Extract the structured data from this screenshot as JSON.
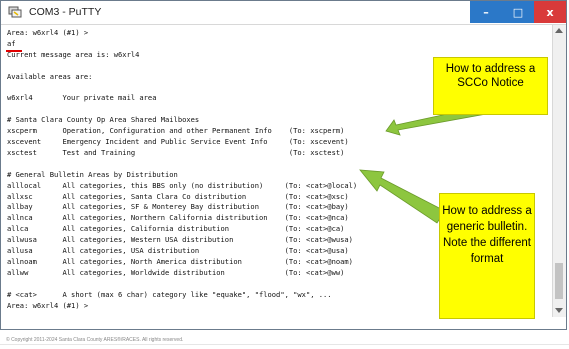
{
  "window": {
    "title": "COM3 - PuTTY"
  },
  "window_controls": {
    "minimize": "–",
    "maximize": "□",
    "close": "x"
  },
  "terminal": {
    "lines": [
      "Area: w6xrl4 (#1) >",
      "af",
      "Current message area is: w6xrl4",
      "",
      "Available areas are:",
      "",
      "w6xrl4       Your private mail area",
      "",
      "# Santa Clara County Op Area Shared Mailboxes",
      "xscperm      Operation, Configuration and other Permanent Info    (To: xscperm)",
      "xscevent     Emergency Incident and Public Service Event Info     (To: xscevent)",
      "xsctest      Test and Training                                    (To: xsctest)",
      "",
      "# General Bulletin Areas by Distribution",
      "alllocal     All categories, this BBS only (no distribution)     (To: <cat>@local)",
      "allxsc       All categories, Santa Clara Co distribution         (To: <cat>@xsc)",
      "allbay       All categories, SF & Monterey Bay distribution      (To: <cat>@bay)",
      "allnca       All categories, Northern California distribution    (To: <cat>@nca)",
      "allca        All categories, California distribution             (To: <cat>@ca)",
      "allwusa      All categories, Western USA distribution            (To: <cat>@wusa)",
      "allusa       All categories, USA distribution                    (To: <cat>@usa)",
      "allnoam      All categories, North America distribution          (To: <cat>@noam)",
      "allww        All categories, Worldwide distribution              (To: <cat>@ww)",
      "",
      "# <cat>      A short (max 6 char) category like \"equake\", \"flood\", \"wx\", ...",
      "Area: w6xrl4 (#1) >"
    ]
  },
  "callouts": {
    "scco_notice": "How to address a SCCo Notice",
    "generic_bulletin": "How to address a generic bulletin.  Note the different format"
  },
  "colors": {
    "callout_fill": "#ffff00",
    "arrow_fill": "#8dc63f",
    "close_button": "#d93a3a",
    "window_button": "#2b78c8",
    "underline": "#e00000"
  },
  "footer": {
    "copyright": "© Copyright 2011-2024 Santa Clara County ARES®/RACES.  All rights reserved."
  }
}
